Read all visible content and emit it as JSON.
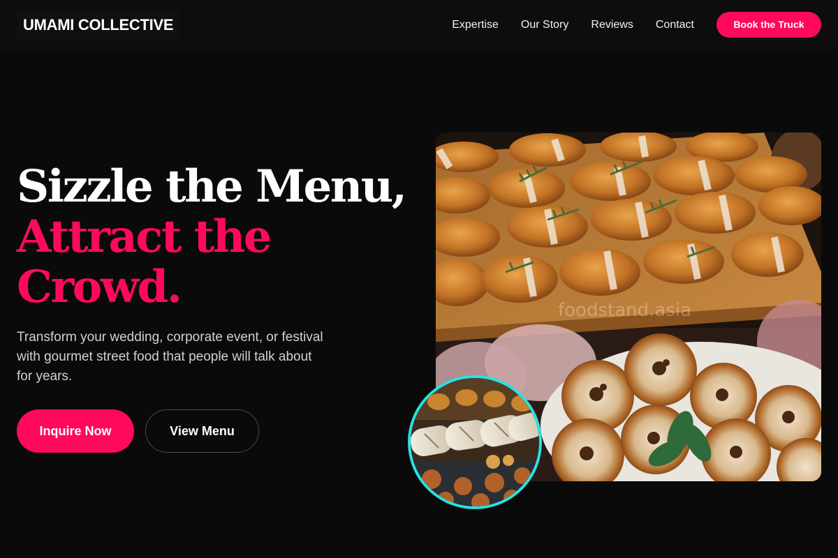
{
  "brand": {
    "name": "UMAMI COLLECTIVE"
  },
  "nav": {
    "links": [
      "Expertise",
      "Our Story",
      "Reviews",
      "Contact"
    ],
    "cta": "Book the Truck"
  },
  "hero": {
    "headline_line1": "Sizzle the Menu,",
    "headline_line2": "Attract the",
    "headline_line3": "Crowd.",
    "description": "Transform your wedding, corporate event, or festival with gourmet street food that people will talk about for years.",
    "primary_button": "Inquire Now",
    "secondary_button": "View Menu"
  },
  "media": {
    "main_photo_watermark": "foodstand.asia",
    "main_photo_icon": "croissant-and-tart-photo",
    "round_photo_icon": "street-food-rolls-photo"
  },
  "colors": {
    "accent": "#ff0a5a",
    "background": "#0a0a0a",
    "ring": "#26e3e3"
  }
}
